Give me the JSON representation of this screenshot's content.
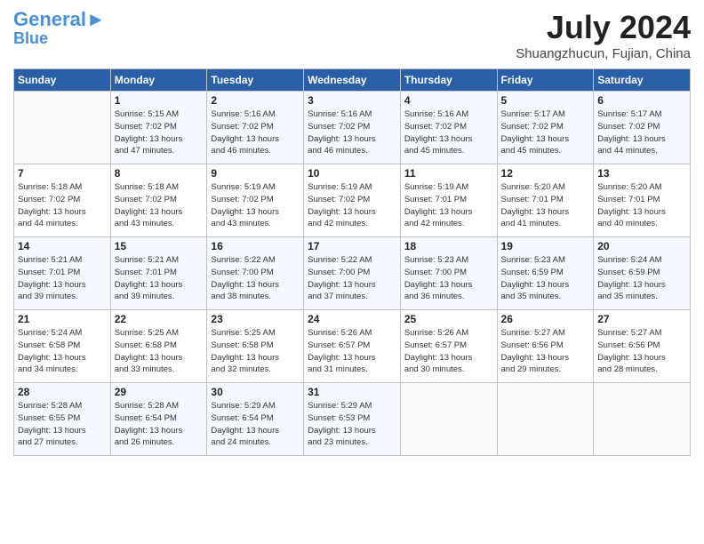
{
  "header": {
    "logo_line1": "General",
    "logo_line2": "Blue",
    "month_year": "July 2024",
    "location": "Shuangzhucun, Fujian, China"
  },
  "weekdays": [
    "Sunday",
    "Monday",
    "Tuesday",
    "Wednesday",
    "Thursday",
    "Friday",
    "Saturday"
  ],
  "weeks": [
    [
      {
        "day": "",
        "info": ""
      },
      {
        "day": "1",
        "info": "Sunrise: 5:15 AM\nSunset: 7:02 PM\nDaylight: 13 hours\nand 47 minutes."
      },
      {
        "day": "2",
        "info": "Sunrise: 5:16 AM\nSunset: 7:02 PM\nDaylight: 13 hours\nand 46 minutes."
      },
      {
        "day": "3",
        "info": "Sunrise: 5:16 AM\nSunset: 7:02 PM\nDaylight: 13 hours\nand 46 minutes."
      },
      {
        "day": "4",
        "info": "Sunrise: 5:16 AM\nSunset: 7:02 PM\nDaylight: 13 hours\nand 45 minutes."
      },
      {
        "day": "5",
        "info": "Sunrise: 5:17 AM\nSunset: 7:02 PM\nDaylight: 13 hours\nand 45 minutes."
      },
      {
        "day": "6",
        "info": "Sunrise: 5:17 AM\nSunset: 7:02 PM\nDaylight: 13 hours\nand 44 minutes."
      }
    ],
    [
      {
        "day": "7",
        "info": "Sunrise: 5:18 AM\nSunset: 7:02 PM\nDaylight: 13 hours\nand 44 minutes."
      },
      {
        "day": "8",
        "info": "Sunrise: 5:18 AM\nSunset: 7:02 PM\nDaylight: 13 hours\nand 43 minutes."
      },
      {
        "day": "9",
        "info": "Sunrise: 5:19 AM\nSunset: 7:02 PM\nDaylight: 13 hours\nand 43 minutes."
      },
      {
        "day": "10",
        "info": "Sunrise: 5:19 AM\nSunset: 7:02 PM\nDaylight: 13 hours\nand 42 minutes."
      },
      {
        "day": "11",
        "info": "Sunrise: 5:19 AM\nSunset: 7:01 PM\nDaylight: 13 hours\nand 42 minutes."
      },
      {
        "day": "12",
        "info": "Sunrise: 5:20 AM\nSunset: 7:01 PM\nDaylight: 13 hours\nand 41 minutes."
      },
      {
        "day": "13",
        "info": "Sunrise: 5:20 AM\nSunset: 7:01 PM\nDaylight: 13 hours\nand 40 minutes."
      }
    ],
    [
      {
        "day": "14",
        "info": "Sunrise: 5:21 AM\nSunset: 7:01 PM\nDaylight: 13 hours\nand 39 minutes."
      },
      {
        "day": "15",
        "info": "Sunrise: 5:21 AM\nSunset: 7:01 PM\nDaylight: 13 hours\nand 39 minutes."
      },
      {
        "day": "16",
        "info": "Sunrise: 5:22 AM\nSunset: 7:00 PM\nDaylight: 13 hours\nand 38 minutes."
      },
      {
        "day": "17",
        "info": "Sunrise: 5:22 AM\nSunset: 7:00 PM\nDaylight: 13 hours\nand 37 minutes."
      },
      {
        "day": "18",
        "info": "Sunrise: 5:23 AM\nSunset: 7:00 PM\nDaylight: 13 hours\nand 36 minutes."
      },
      {
        "day": "19",
        "info": "Sunrise: 5:23 AM\nSunset: 6:59 PM\nDaylight: 13 hours\nand 35 minutes."
      },
      {
        "day": "20",
        "info": "Sunrise: 5:24 AM\nSunset: 6:59 PM\nDaylight: 13 hours\nand 35 minutes."
      }
    ],
    [
      {
        "day": "21",
        "info": "Sunrise: 5:24 AM\nSunset: 6:58 PM\nDaylight: 13 hours\nand 34 minutes."
      },
      {
        "day": "22",
        "info": "Sunrise: 5:25 AM\nSunset: 6:58 PM\nDaylight: 13 hours\nand 33 minutes."
      },
      {
        "day": "23",
        "info": "Sunrise: 5:25 AM\nSunset: 6:58 PM\nDaylight: 13 hours\nand 32 minutes."
      },
      {
        "day": "24",
        "info": "Sunrise: 5:26 AM\nSunset: 6:57 PM\nDaylight: 13 hours\nand 31 minutes."
      },
      {
        "day": "25",
        "info": "Sunrise: 5:26 AM\nSunset: 6:57 PM\nDaylight: 13 hours\nand 30 minutes."
      },
      {
        "day": "26",
        "info": "Sunrise: 5:27 AM\nSunset: 6:56 PM\nDaylight: 13 hours\nand 29 minutes."
      },
      {
        "day": "27",
        "info": "Sunrise: 5:27 AM\nSunset: 6:56 PM\nDaylight: 13 hours\nand 28 minutes."
      }
    ],
    [
      {
        "day": "28",
        "info": "Sunrise: 5:28 AM\nSunset: 6:55 PM\nDaylight: 13 hours\nand 27 minutes."
      },
      {
        "day": "29",
        "info": "Sunrise: 5:28 AM\nSunset: 6:54 PM\nDaylight: 13 hours\nand 26 minutes."
      },
      {
        "day": "30",
        "info": "Sunrise: 5:29 AM\nSunset: 6:54 PM\nDaylight: 13 hours\nand 24 minutes."
      },
      {
        "day": "31",
        "info": "Sunrise: 5:29 AM\nSunset: 6:53 PM\nDaylight: 13 hours\nand 23 minutes."
      },
      {
        "day": "",
        "info": ""
      },
      {
        "day": "",
        "info": ""
      },
      {
        "day": "",
        "info": ""
      }
    ]
  ]
}
